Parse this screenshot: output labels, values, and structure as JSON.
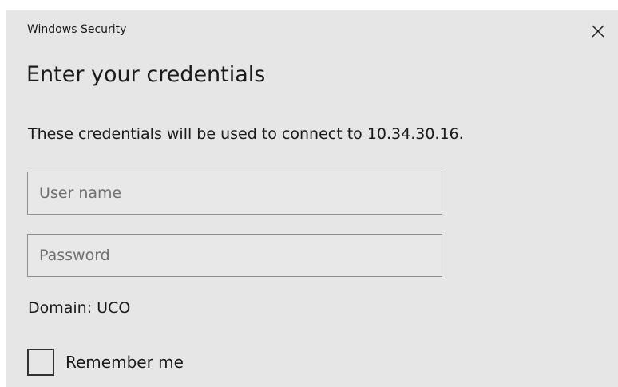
{
  "window": {
    "title": "Windows Security",
    "close_icon": "close-icon"
  },
  "dialog": {
    "heading": "Enter your credentials",
    "message": "These credentials will be used to connect to 10.34.30.16."
  },
  "form": {
    "username": {
      "placeholder": "User name",
      "value": ""
    },
    "password": {
      "placeholder": "Password",
      "value": ""
    },
    "domain_text": "Domain: UCO",
    "remember": {
      "label": "Remember me",
      "checked": false
    }
  },
  "colors": {
    "dialog_background": "#e6e6e6",
    "field_border": "#8f8f8f",
    "text": "#1a1a1a",
    "placeholder": "#6f6f6f"
  }
}
